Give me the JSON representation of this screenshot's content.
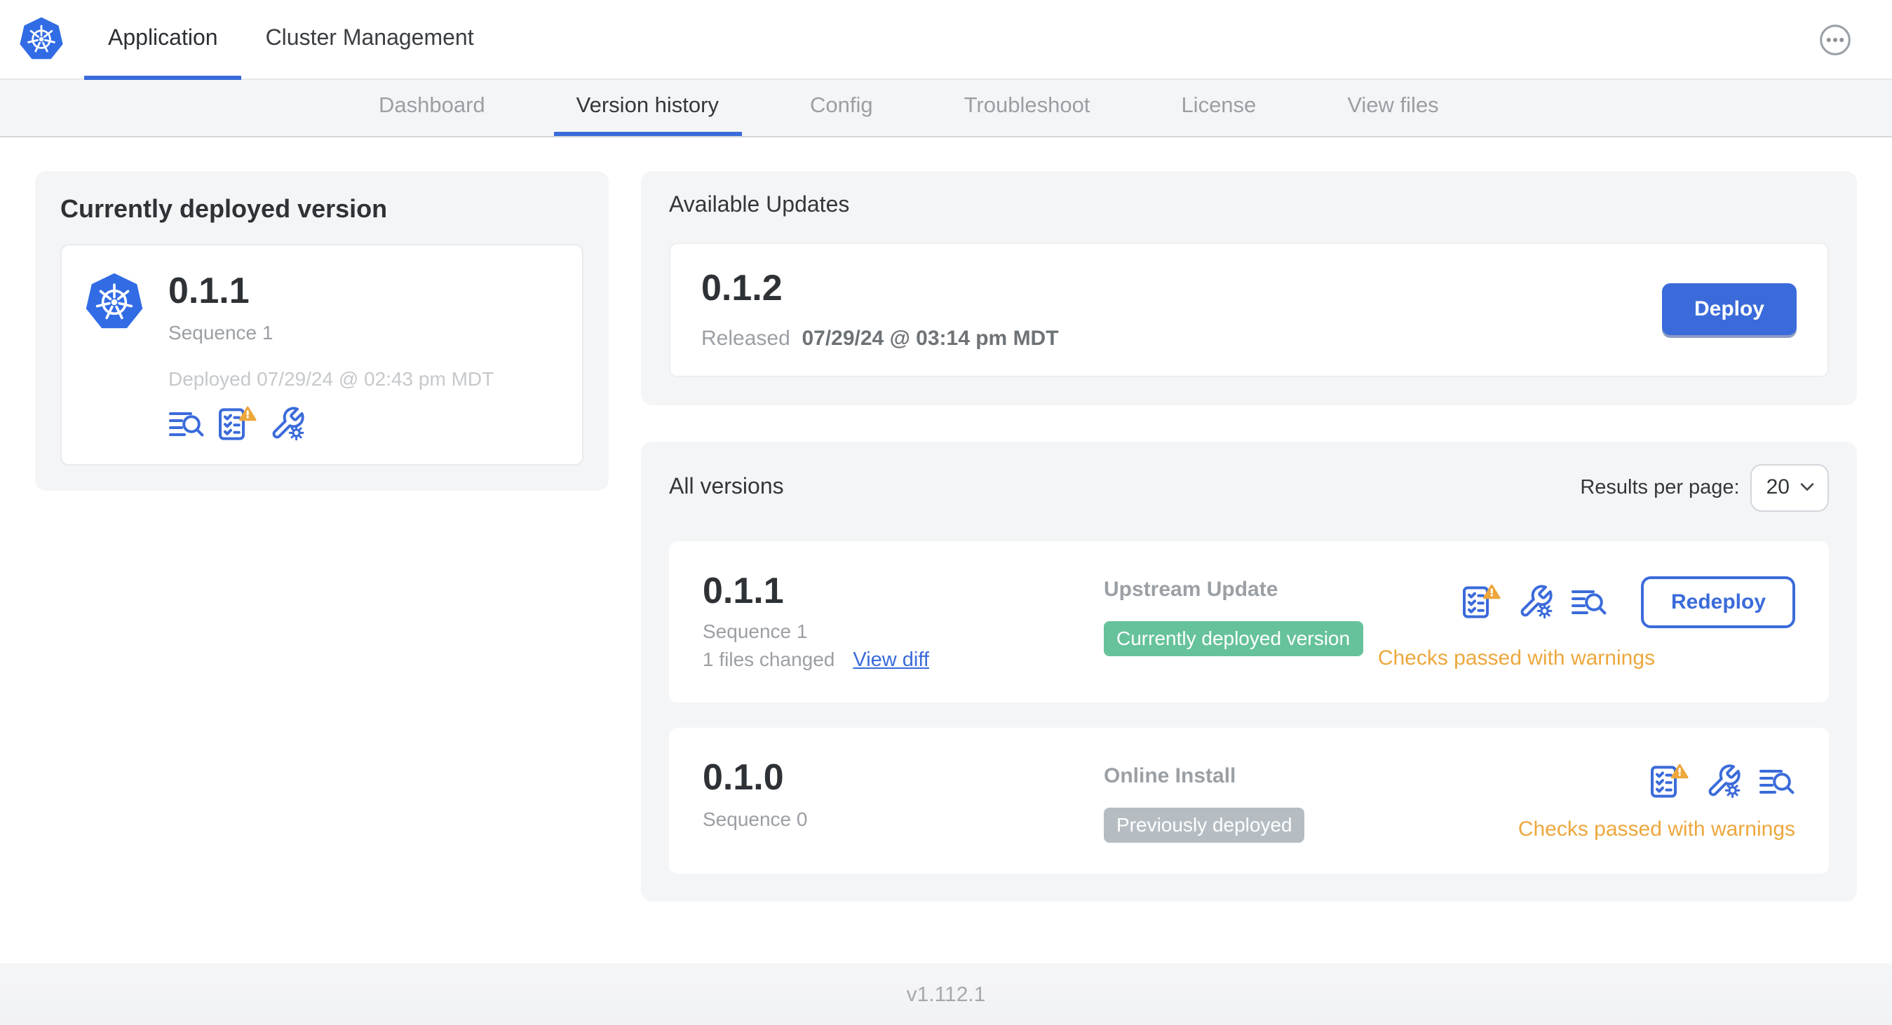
{
  "colors": {
    "accent_blue": "#3b6bda",
    "logo_blue": "#326CE5",
    "badge_green": "#66c29a",
    "badge_gray": "#b5bdc3",
    "warning_amber": "#eda73c",
    "panel_gray": "#f4f5f7"
  },
  "topnav": {
    "tabs": [
      {
        "label": "Application",
        "active": true
      },
      {
        "label": "Cluster Management",
        "active": false
      }
    ],
    "more_menu_icon": "ellipsis-icon"
  },
  "subnav": {
    "tabs": [
      {
        "label": "Dashboard",
        "active": false
      },
      {
        "label": "Version history",
        "active": true
      },
      {
        "label": "Config",
        "active": false
      },
      {
        "label": "Troubleshoot",
        "active": false
      },
      {
        "label": "License",
        "active": false
      },
      {
        "label": "View files",
        "active": false
      }
    ]
  },
  "current_version_card": {
    "title": "Currently deployed version",
    "app_icon": "kubernetes-logo",
    "version": "0.1.1",
    "sequence": "Sequence 1",
    "deployed_at": "Deployed 07/29/24 @ 02:43 pm MDT",
    "icons": [
      "release-notes-icon",
      "preflight-checks-warning-icon",
      "config-icon"
    ]
  },
  "available_updates": {
    "title": "Available Updates",
    "version": "0.1.2",
    "released_label": "Released",
    "released_date": "07/29/24 @ 03:14 pm MDT",
    "deploy_label": "Deploy"
  },
  "all_versions": {
    "title": "All versions",
    "results_per_page_label": "Results per page:",
    "results_per_page_value": "20",
    "rows": [
      {
        "version": "0.1.1",
        "sequence": "Sequence 1",
        "files_changed": "1 files changed",
        "view_diff_label": "View diff",
        "source": "Upstream Update",
        "badge_label": "Currently deployed version",
        "badge_color": "#66c29a",
        "icons": [
          "preflight-checks-warning-icon",
          "config-icon",
          "release-notes-icon"
        ],
        "checks_label": "Checks passed with warnings",
        "action_label": "Redeploy"
      },
      {
        "version": "0.1.0",
        "sequence": "Sequence 0",
        "source": "Online Install",
        "badge_label": "Previously deployed",
        "badge_color": "#b5bdc3",
        "icons": [
          "preflight-checks-warning-icon",
          "config-icon",
          "release-notes-icon"
        ],
        "checks_label": "Checks passed with warnings"
      }
    ]
  },
  "footer": {
    "app_version": "v1.112.1"
  }
}
